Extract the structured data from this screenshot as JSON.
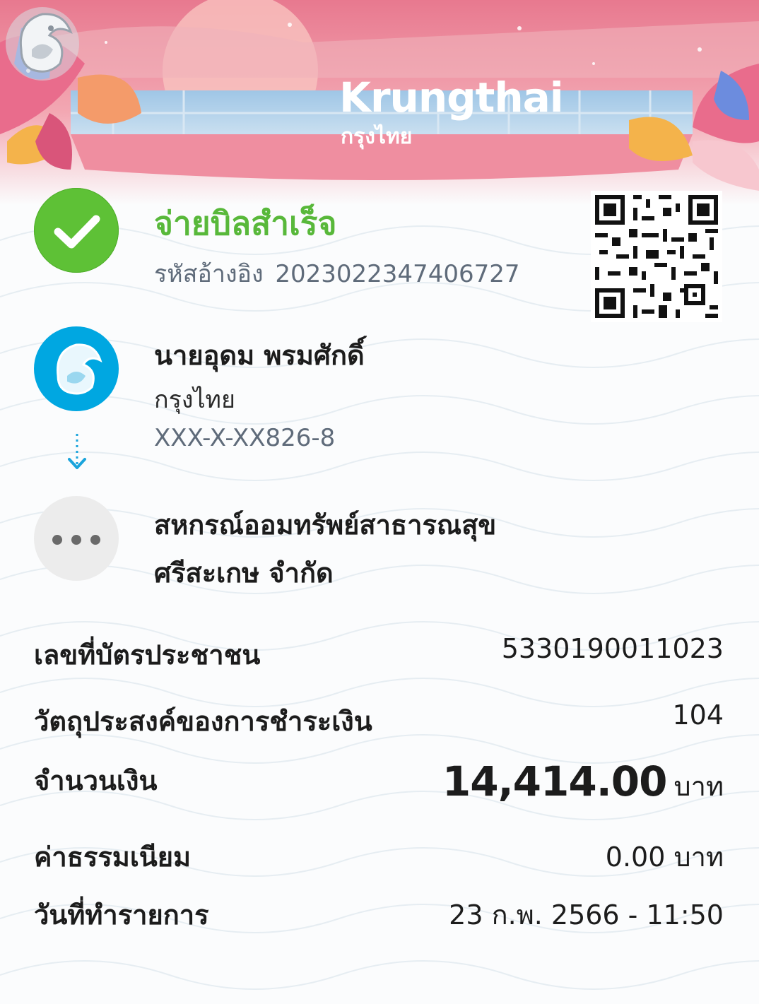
{
  "brand": {
    "name_en": "Krungthai",
    "name_th": "กรุงไทย"
  },
  "status": {
    "title": "จ่ายบิลสำเร็จ",
    "ref_label": "รหัสอ้างอิง",
    "ref_value": "2023022347406727",
    "icon": "check-icon"
  },
  "sender": {
    "name": "นายอุดม พรมศักดิ์",
    "bank": "กรุงไทย",
    "account": "XXX-X-XX826-8"
  },
  "receiver": {
    "name_line1": "สหกรณ์ออมทรัพย์สาธารณสุข",
    "name_line2": "ศรีสะเกษ จำกัด"
  },
  "details": {
    "citizen_id": {
      "label": "เลขที่บัตรประชาชน",
      "value": "5330190011023"
    },
    "purpose": {
      "label": "วัตถุประสงค์ของการชำระเงิน",
      "value": "104"
    },
    "amount": {
      "label": "จำนวนเงิน",
      "value": "14,414.00",
      "unit": "บาท"
    },
    "fee": {
      "label": "ค่าธรรมเนียม",
      "value": "0.00 บาท"
    },
    "date": {
      "label": "วันที่ทำรายการ",
      "value": "23 ก.พ. 2566 - 11:50"
    }
  },
  "colors": {
    "success": "#5ec136",
    "brand_blue": "#00a7e1",
    "header_pink": "#ef8aa0"
  }
}
